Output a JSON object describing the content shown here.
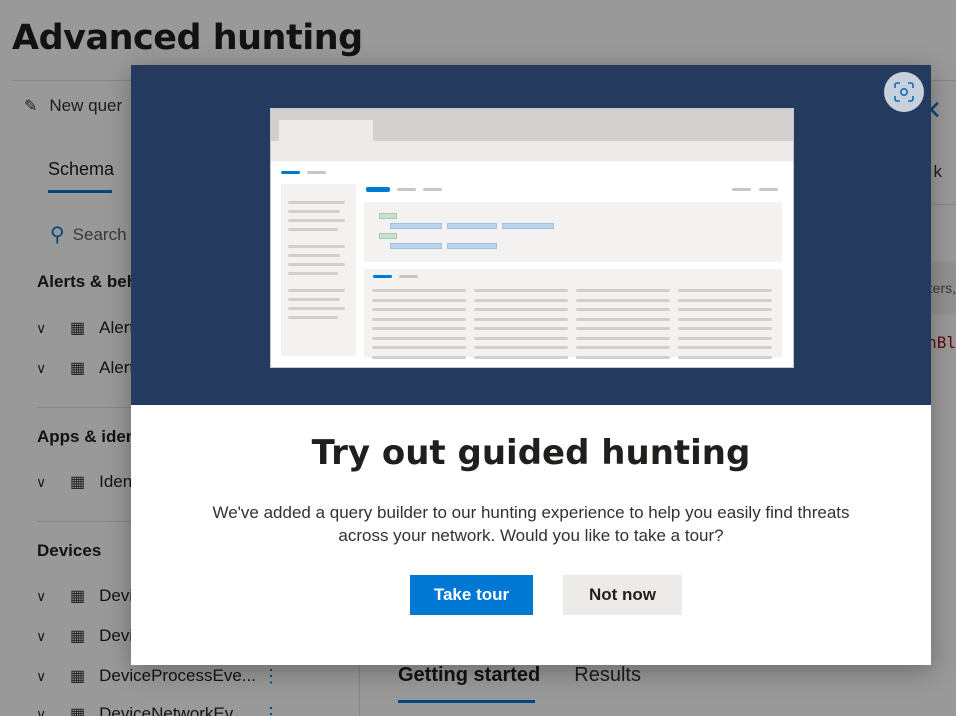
{
  "page": {
    "title": "Advanced hunting",
    "toolbar": {
      "new_query_label": "New quer"
    },
    "right": {
      "link_fragment": "k",
      "filter_fragment": "ters,",
      "code_fragment": "nBl"
    },
    "schema": {
      "tab_label": "Schema",
      "search_placeholder": "Search",
      "groups": [
        {
          "title": "Alerts & beh",
          "items": [
            "Alert",
            "Alert"
          ]
        },
        {
          "title": "Apps & ider",
          "items": [
            "Iden"
          ]
        },
        {
          "title": "Devices",
          "items": [
            "Devi",
            "Devi",
            "DeviceProcessEve...",
            "DeviceNetworkEv..."
          ]
        }
      ]
    },
    "bottom_tabs": {
      "getting_started": "Getting started",
      "results": "Results"
    }
  },
  "modal": {
    "title": "Try out guided hunting",
    "description": "We've added a query builder to our hunting experience to help you easily find threats across your network. Would you like to take a tour?",
    "take_tour_label": "Take tour",
    "not_now_label": "Not now",
    "hero_color": "#243a5e",
    "accent_color": "#0078d4"
  },
  "icons": {
    "edit": "edit-icon",
    "close": "close-icon",
    "search": "search-icon",
    "chevron": "chevron-down-icon",
    "table": "table-icon",
    "more": "more-vertical-icon",
    "expand": "expand-focus-icon"
  }
}
